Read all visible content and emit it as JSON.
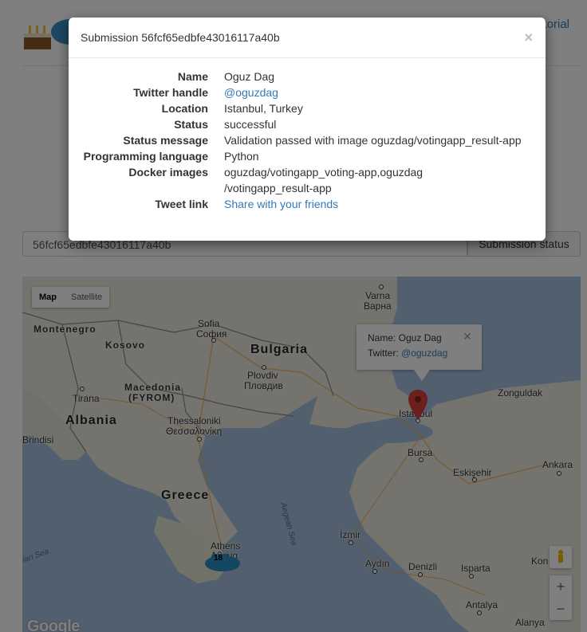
{
  "page": {
    "nav_link": "torial"
  },
  "submission_form": {
    "input_value": "56fcf65edbfe43016117a40b",
    "button_label": "Submission status"
  },
  "map": {
    "type_controls": [
      "Map",
      "Satellite"
    ],
    "active_type": "Map",
    "labels": {
      "montenegro": "Montenegro",
      "kosovo": "Kosovo",
      "sofia": "Sofia",
      "sofia_local": "София",
      "bulgaria": "Bulgaria",
      "varna": "Varna",
      "varna_local": "Варна",
      "plovdiv": "Plovdiv",
      "plovdiv_local": "Пловдив",
      "macedonia": "Macedonia",
      "fyrom": "(FYROM)",
      "tirana": "Tirana",
      "albania": "Albania",
      "thessaloniki": "Thessaloniki",
      "thessaloniki_local": "Θεσσαλονίκη",
      "brindisi": "Brindisi",
      "greece": "Greece",
      "aegean_sea": "Aegean Sea",
      "ionian_sea": "ian Sea",
      "athens": "Athens",
      "athens_local": "Αθηνα",
      "istanbul": "Istanbul",
      "zonguldak": "Zonguldak",
      "bursa": "Bursa",
      "eskisehir": "Eskişehir",
      "ankara": "Ankara",
      "izmir": "İzmir",
      "aydin": "Aydın",
      "denizli": "Denizli",
      "isparta": "Isparta",
      "antalya": "Antalya",
      "alanya": "Alanya",
      "kon": "Kon",
      "google": "Google"
    },
    "info_window": {
      "name_label": "Name: Oguz Dag",
      "twitter_prefix": "Twitter: ",
      "twitter_handle": "@oguzdag"
    },
    "cluster_count": "18",
    "zoom_in": "+",
    "zoom_out": "−"
  },
  "modal": {
    "title": "Submission 56fcf65edbfe43016117a40b",
    "close": "×",
    "details": [
      {
        "term": "Name",
        "value": "Oguz Dag"
      },
      {
        "term": "Twitter handle",
        "value": "@oguzdag"
      },
      {
        "term": "Location",
        "value": "Istanbul, Turkey"
      },
      {
        "term": "Status",
        "value": "successful"
      },
      {
        "term": "Status message",
        "value": "Validation passed with image oguzdag/votingapp_result-app"
      },
      {
        "term": "Programming language",
        "value": "Python"
      },
      {
        "term": "Docker images",
        "value": "oguzdag/votingapp_voting-app,oguzdag /votingapp_result-app"
      },
      {
        "term": "Tweet link",
        "value": "Share with your friends"
      }
    ]
  },
  "colors": {
    "link": "#337ab7",
    "water": "#a5bfdd",
    "land": "#f2efe9",
    "pin": "#d9403a"
  }
}
